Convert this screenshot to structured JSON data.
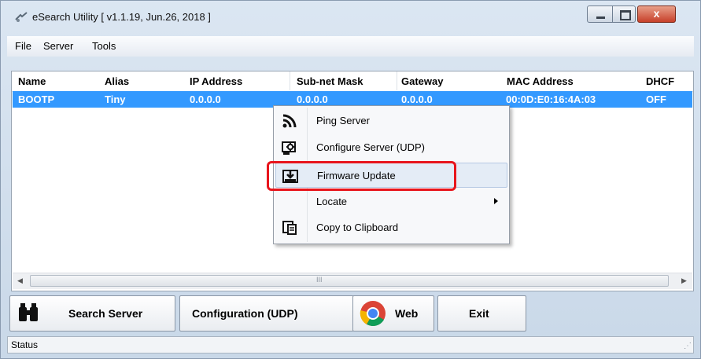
{
  "window": {
    "title": "eSearch Utility [ v1.1.19, Jun.26, 2018 ]",
    "close_label": "x"
  },
  "menubar": {
    "file": "File",
    "server": "Server",
    "tools": "Tools"
  },
  "list": {
    "columns": [
      "Name",
      "Alias",
      "IP Address",
      "Sub-net Mask",
      "Gateway",
      "MAC Address",
      "DHCF"
    ],
    "rows": [
      {
        "name": "BOOTP",
        "alias": "Tiny",
        "ip": "0.0.0.0",
        "mask": "0.0.0.0",
        "gateway": "0.0.0.0",
        "mac": "00:0D:E0:16:4A:03",
        "dhcp": "OFF"
      }
    ]
  },
  "scrollbar": {
    "grip": "III"
  },
  "context_menu": {
    "items": [
      {
        "label": "Ping Server",
        "icon": "rss-icon"
      },
      {
        "label": "Configure Server (UDP)",
        "icon": "gear-screen-icon"
      },
      {
        "label": "Firmware Update",
        "icon": "download-box-icon"
      },
      {
        "label": "Locate",
        "icon": ""
      },
      {
        "label": "Copy to Clipboard",
        "icon": "clipboard-icon"
      }
    ],
    "highlight_color": "#e8151c"
  },
  "toolbar": {
    "search": "Search Server",
    "config": "Configuration (UDP)",
    "web": "Web",
    "exit": "Exit"
  },
  "status": {
    "text": "Status"
  },
  "colors": {
    "selection": "#3399ff",
    "accent_red": "#e8151c"
  }
}
